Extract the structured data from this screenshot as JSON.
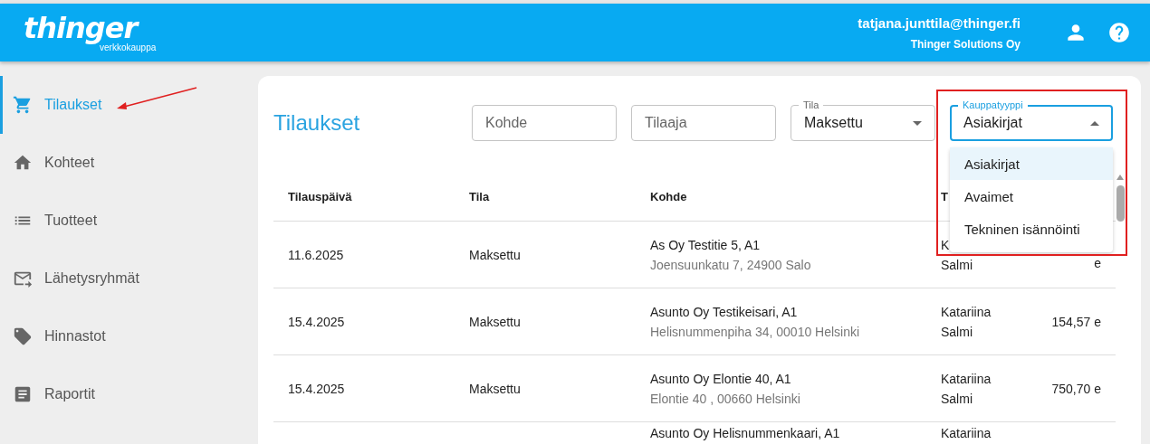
{
  "header": {
    "logo": "thinger",
    "logo_subtitle": "verkkokauppa",
    "user_email": "tatjana.junttila@thinger.fi",
    "company": "Thinger Solutions Oy"
  },
  "sidebar": {
    "items": [
      {
        "label": "Tilaukset",
        "selected": true
      },
      {
        "label": "Kohteet",
        "selected": false
      },
      {
        "label": "Tuotteet",
        "selected": false
      },
      {
        "label": "Lähetysryhmät",
        "selected": false
      },
      {
        "label": "Hinnastot",
        "selected": false
      },
      {
        "label": "Raportit",
        "selected": false
      }
    ]
  },
  "page": {
    "title": "Tilaukset",
    "filters": [
      {
        "kind": "text",
        "placeholder": "Kohde"
      },
      {
        "kind": "text",
        "placeholder": "Tilaaja"
      },
      {
        "kind": "select",
        "label": "Tila",
        "value": "Maksettu",
        "expanded": false
      },
      {
        "kind": "select",
        "label": "Kauppatyyppi",
        "value": "Asiakirjat",
        "expanded": true,
        "options": [
          {
            "label": "Asiakirjat",
            "selected": true
          },
          {
            "label": "Avaimet",
            "selected": false
          },
          {
            "label": "Tekninen isännöinti",
            "selected": false
          }
        ]
      }
    ]
  },
  "table": {
    "columns": [
      "Tilauspäivä",
      "Tila",
      "Kohde",
      "T"
    ],
    "rows": [
      {
        "date": "11.6.2025",
        "status": "Maksettu",
        "target": "As Oy Testitie 5, A1",
        "address": "Joensuunkatu 7, 24900 Salo",
        "customer": [
          "K",
          "Salmi"
        ],
        "total": "e"
      },
      {
        "date": "15.4.2025",
        "status": "Maksettu",
        "target": "Asunto Oy Testikeisari, A1",
        "address": "Helisnummenpiha 34, 00010 Helsinki",
        "customer": [
          "Katariina",
          "Salmi"
        ],
        "total": "154,57 e"
      },
      {
        "date": "15.4.2025",
        "status": "Maksettu",
        "target": "Asunto Oy Elontie 40, A1",
        "address": "Elontie 40 , 00660 Helsinki",
        "customer": [
          "Katariina",
          "Salmi"
        ],
        "total": "750,70 e"
      },
      {
        "target": "Asunto Oy Helisnummenkaari, A1",
        "customer": [
          "Katariina"
        ]
      }
    ]
  }
}
